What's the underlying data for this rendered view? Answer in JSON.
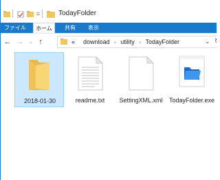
{
  "window": {
    "title": "TodayFolder"
  },
  "ribbon": {
    "tabs": [
      {
        "label": "ファイル"
      },
      {
        "label": "ホーム"
      },
      {
        "label": "共有"
      },
      {
        "label": "表示"
      }
    ]
  },
  "address": {
    "overflow": "«",
    "crumbs": [
      "download",
      "utility",
      "TodayFolder"
    ],
    "separator": "›"
  },
  "items": [
    {
      "label": "2018-01-30",
      "icon": "folder-icon",
      "selected": true
    },
    {
      "label": "readme.txt",
      "icon": "text-file-icon",
      "selected": false
    },
    {
      "label": "SettingXML.xml",
      "icon": "xml-file-icon",
      "selected": false
    },
    {
      "label": "TodayFolder.exe",
      "icon": "exe-icon",
      "selected": false
    }
  ],
  "colors": {
    "ribbon": "#1979ca",
    "selection": "#cce8ff",
    "folder": "#f0c75e"
  }
}
